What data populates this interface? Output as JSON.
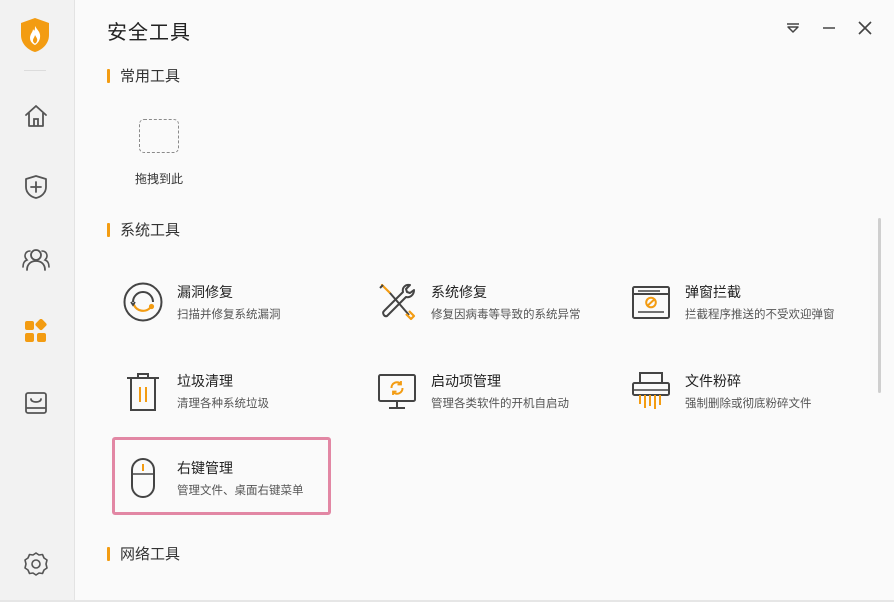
{
  "app": {
    "title": "安全工具"
  },
  "sidebar": {
    "items": [
      {
        "icon": "home-icon",
        "active": false
      },
      {
        "icon": "shield-plus-icon",
        "active": false
      },
      {
        "icon": "users-icon",
        "active": false
      },
      {
        "icon": "apps-grid-icon",
        "active": true
      },
      {
        "icon": "inbox-tray-icon",
        "active": false
      },
      {
        "icon": "settings-gear-icon",
        "active": false
      }
    ]
  },
  "window_controls": [
    "dropdown-menu-icon",
    "minimize-icon",
    "close-icon"
  ],
  "sections": {
    "common": {
      "title": "常用工具",
      "drop_label": "拖拽到此"
    },
    "system": {
      "title": "系统工具",
      "tools": [
        {
          "name": "漏洞修复",
          "desc": "扫描并修复系统漏洞",
          "icon": "vulnerability-fix-icon"
        },
        {
          "name": "系统修复",
          "desc": "修复因病毒等导致的系统异常",
          "icon": "wrench-tools-icon"
        },
        {
          "name": "弹窗拦截",
          "desc": "拦截程序推送的不受欢迎弹窗",
          "icon": "popup-block-icon"
        },
        {
          "name": "垃圾清理",
          "desc": "清理各种系统垃圾",
          "icon": "trash-icon"
        },
        {
          "name": "启动项管理",
          "desc": "管理各类软件的开机自启动",
          "icon": "monitor-startup-icon"
        },
        {
          "name": "文件粉碎",
          "desc": "强制删除或彻底粉碎文件",
          "icon": "shredder-icon"
        },
        {
          "name": "右键管理",
          "desc": "管理文件、桌面右键菜单",
          "icon": "mouse-icon"
        }
      ]
    },
    "network": {
      "title": "网络工具"
    }
  },
  "colors": {
    "accent": "#f39c12",
    "icon_gray": "#444444",
    "highlight": "#e287a4"
  }
}
